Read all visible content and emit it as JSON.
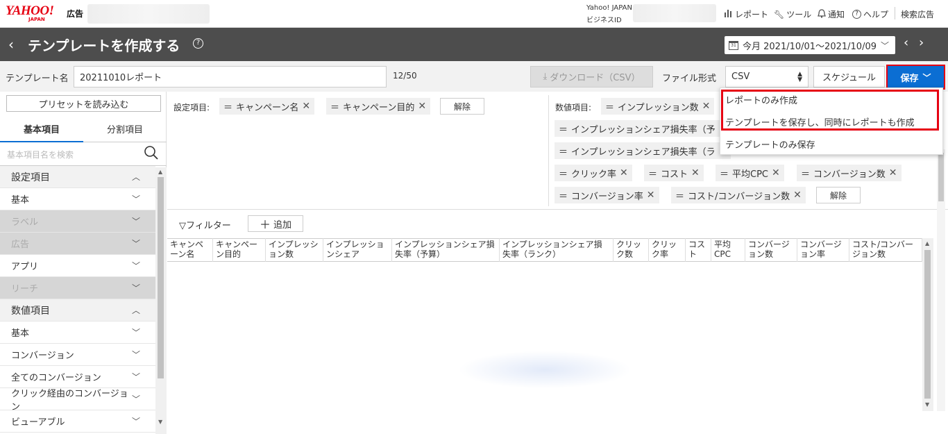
{
  "header": {
    "logo": "YAHOO!",
    "logo_sub": "JAPAN",
    "logo_ad": "広告",
    "yj_line1": "Yahoo! JAPAN",
    "yj_line2": "ビジネスID",
    "nav": {
      "report": "レポート",
      "tools": "ツール",
      "notify": "通知",
      "help": "ヘルプ",
      "search_ads": "検索広告"
    }
  },
  "titlebar": {
    "back": "‹",
    "title": "テンプレートを作成する",
    "help": "?",
    "date_range": "今月 2021/10/01～2021/10/09",
    "prev": "‹",
    "next": "›"
  },
  "template": {
    "label": "テンプレート名",
    "name_value": "20211010レポート",
    "count": "12/50",
    "download": "ダウンロード（CSV）",
    "format_label": "ファイル形式",
    "format_value": "CSV",
    "schedule": "スケジュール",
    "save": "保存"
  },
  "dropdown": {
    "items": [
      "レポートのみ作成",
      "テンプレートを保存し、同時にレポートも作成",
      "テンプレートのみ保存"
    ]
  },
  "left": {
    "preset": "プリセットを読み込む",
    "tab_basic": "基本項目",
    "tab_split": "分割項目",
    "search_placeholder": "基本項目名を検索",
    "items": [
      {
        "label": "設定項目",
        "type": "head"
      },
      {
        "label": "基本",
        "type": "item"
      },
      {
        "label": "ラベル",
        "type": "dis"
      },
      {
        "label": "広告",
        "type": "dis"
      },
      {
        "label": "アプリ",
        "type": "item"
      },
      {
        "label": "リーチ",
        "type": "dis"
      },
      {
        "label": "数値項目",
        "type": "head"
      },
      {
        "label": "基本",
        "type": "item"
      },
      {
        "label": "コンバージョン",
        "type": "item"
      },
      {
        "label": "全てのコンバージョン",
        "type": "item"
      },
      {
        "label": "クリック経由のコンバージョン",
        "type": "item"
      },
      {
        "label": "ビューアブル",
        "type": "item"
      }
    ]
  },
  "settings": {
    "label": "設定項目:",
    "chips": [
      "キャンペーン名",
      "キャンペーン目的"
    ],
    "clear": "解除"
  },
  "metrics": {
    "label": "数値項目:",
    "chips": [
      "インプレッション数",
      "インプレッションシェア損失率（予",
      "インプレッションシェア損失率（ラ",
      "クリック率",
      "コスト",
      "平均CPC",
      "コンバージョン数",
      "コンバージョン率",
      "コスト/コンバージョン数"
    ],
    "clear": "解除"
  },
  "filter": {
    "label": "フィルター",
    "add": "追加"
  },
  "table": {
    "headers": [
      "キャンペーン名",
      "キャンペーン目的",
      "インプレッション数",
      "インプレッションシェア",
      "インプレッションシェア損失率（予算）",
      "インプレッションシェア損失率（ランク）",
      "クリック数",
      "クリック率",
      "コスト",
      "平均CPC",
      "コンバージョン数",
      "コンバージョン率",
      "コスト/コンバージョン数"
    ]
  }
}
